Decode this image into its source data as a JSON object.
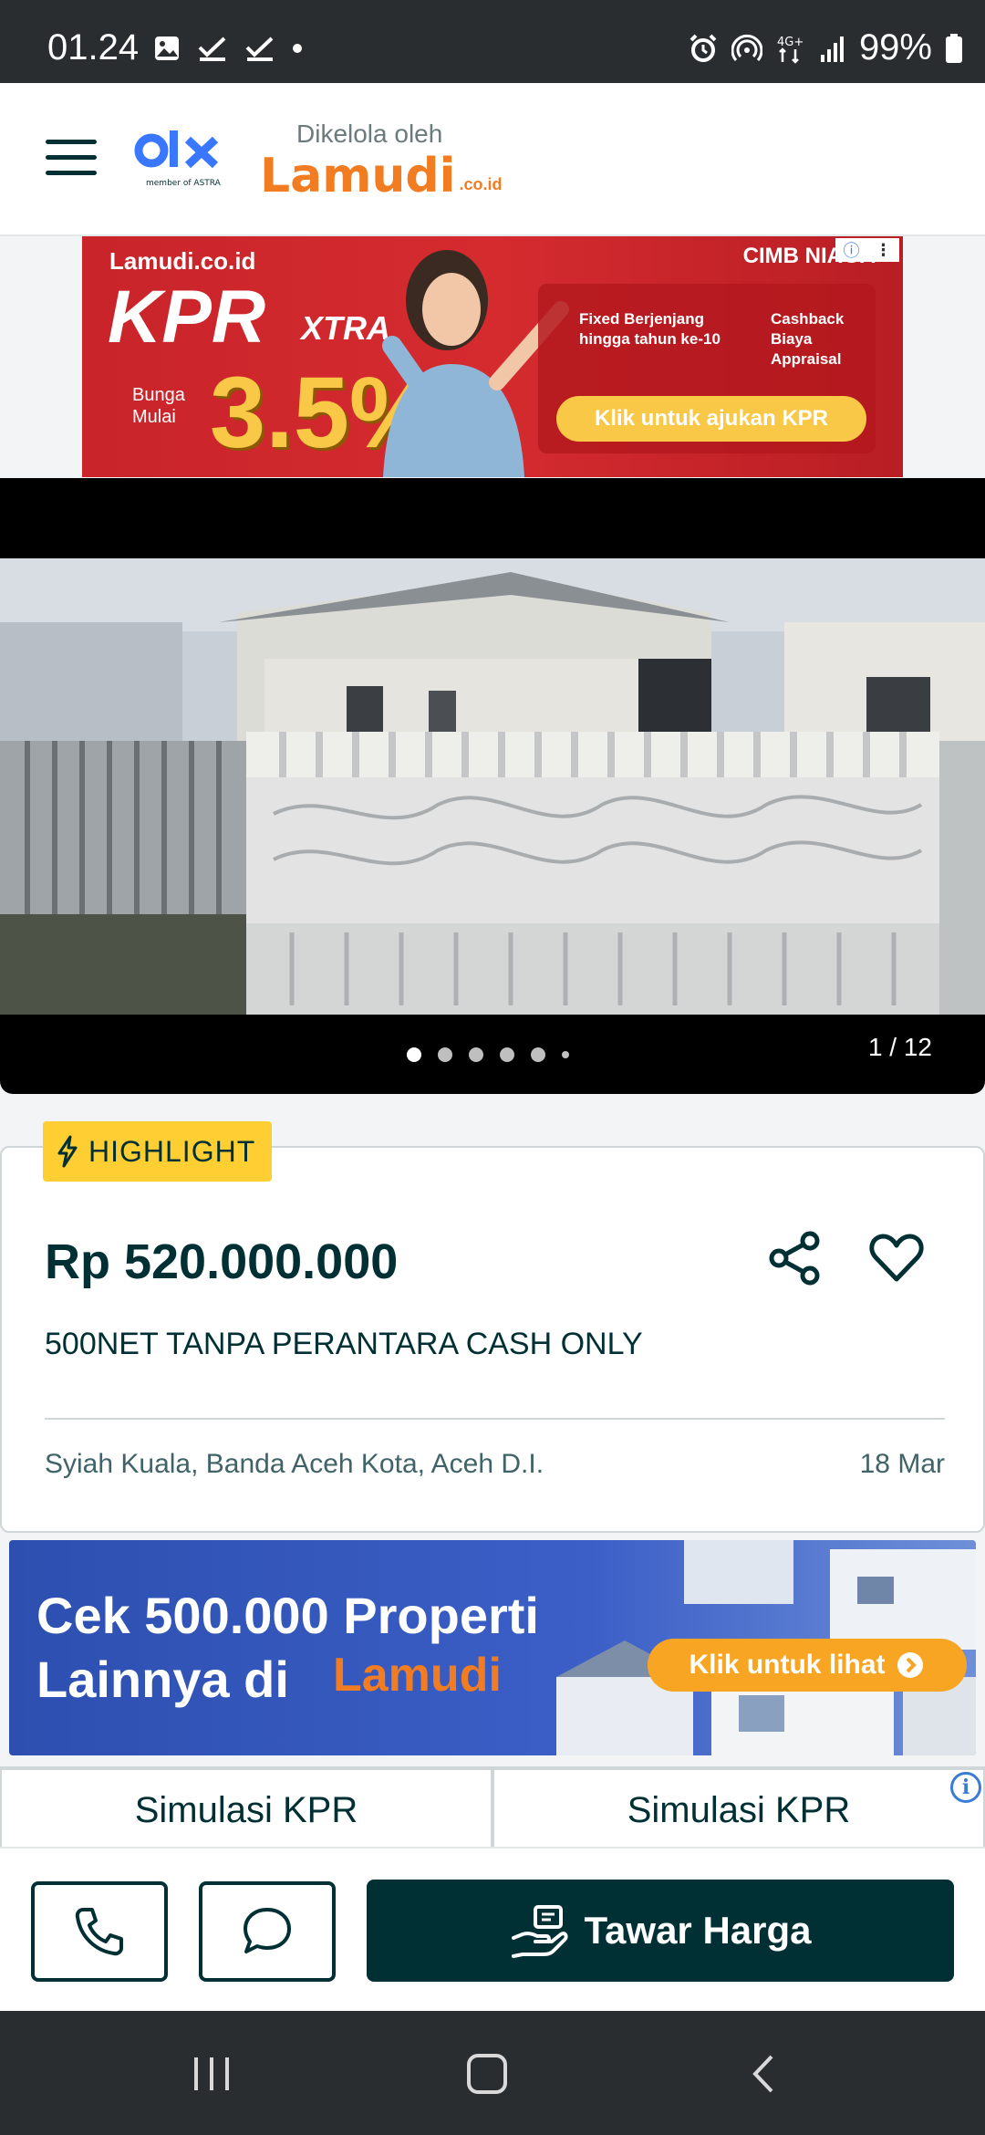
{
  "status_bar": {
    "time": "01.24",
    "network": "4G+",
    "battery": "99%"
  },
  "header": {
    "olx_logo_text": "olx",
    "olx_tagline": "member of ASTRA",
    "managed_by": "Dikelola oleh",
    "partner_logo": "Lamudi",
    "partner_logo_suffix": ".co.id"
  },
  "ad_banner": {
    "brand": "Lamudi.co.id",
    "product": "KPR",
    "product_suffix": "XTRA",
    "rate_label": "Bunga Mulai",
    "rate": "3.5%",
    "bank": "CIMB NIAGA",
    "feature_1": "Fixed Berjenjang hingga tahun ke-10",
    "feature_2": "Cashback Biaya Appraisal",
    "cta": "Klik untuk ajukan KPR"
  },
  "gallery": {
    "counter": "1 / 12",
    "dots": 6,
    "active_dot": 0
  },
  "listing": {
    "badge": "HIGHLIGHT",
    "price": "Rp 520.000.000",
    "title": "500NET TANPA PERANTARA CASH ONLY",
    "location": "Syiah Kuala, Banda Aceh Kota, Aceh D.I.",
    "date": "18 Mar"
  },
  "promo_banner": {
    "line1": "Cek 500.000 Properti",
    "line2": "Lainnya di",
    "brand": "Lamudi",
    "cta": "Klik untuk lihat"
  },
  "simulasi": {
    "tab1": "Simulasi KPR",
    "tab2": "Simulasi KPR"
  },
  "actions": {
    "offer_label": "Tawar Harga"
  },
  "colors": {
    "primary": "#002f34",
    "highlight": "#ffce32",
    "lamudi_orange": "#f27c21",
    "olx_blue": "#3a77ff"
  }
}
